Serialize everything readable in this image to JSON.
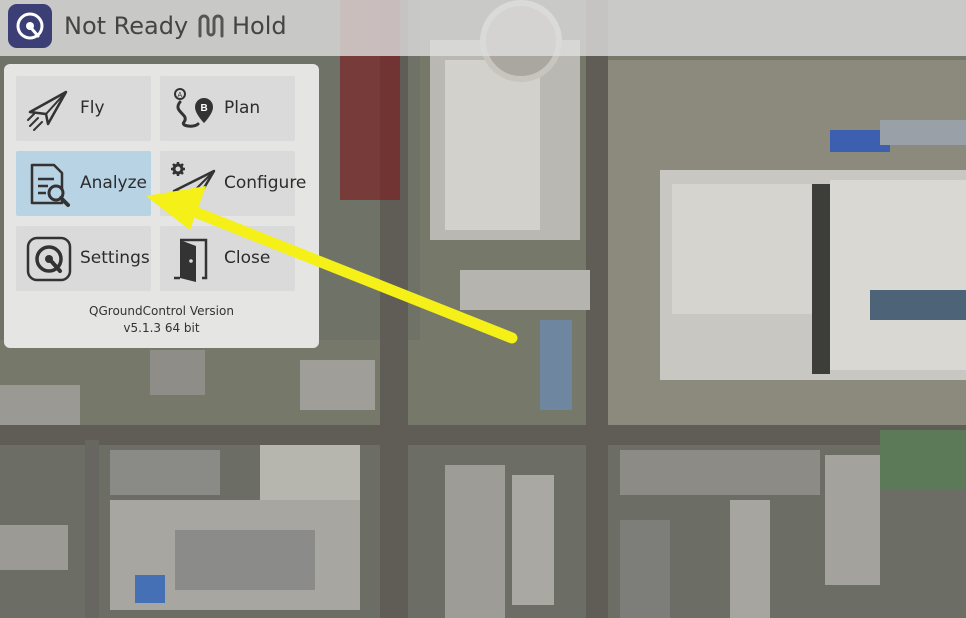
{
  "toolbar": {
    "status": "Not Ready",
    "flight_mode": "Hold"
  },
  "menu": {
    "items": [
      {
        "label": "Fly"
      },
      {
        "label": "Plan"
      },
      {
        "label": "Analyze",
        "selected": true
      },
      {
        "label": "Configure"
      },
      {
        "label": "Settings"
      },
      {
        "label": "Close"
      }
    ],
    "version_line1": "QGroundControl Version",
    "version_line2": "v5.1.3 64 bit"
  },
  "colors": {
    "toolbar_bg": "#dedede",
    "logo_bg": "#3c3f76",
    "selected_tile": "#b8d3e3",
    "tile_bg": "#dadada",
    "annotation_arrow": "#f4f018"
  },
  "icons": [
    "qgc-logo-icon",
    "hold-icon",
    "fly-icon",
    "plan-icon",
    "analyze-icon",
    "configure-icon",
    "settings-icon",
    "close-icon"
  ]
}
